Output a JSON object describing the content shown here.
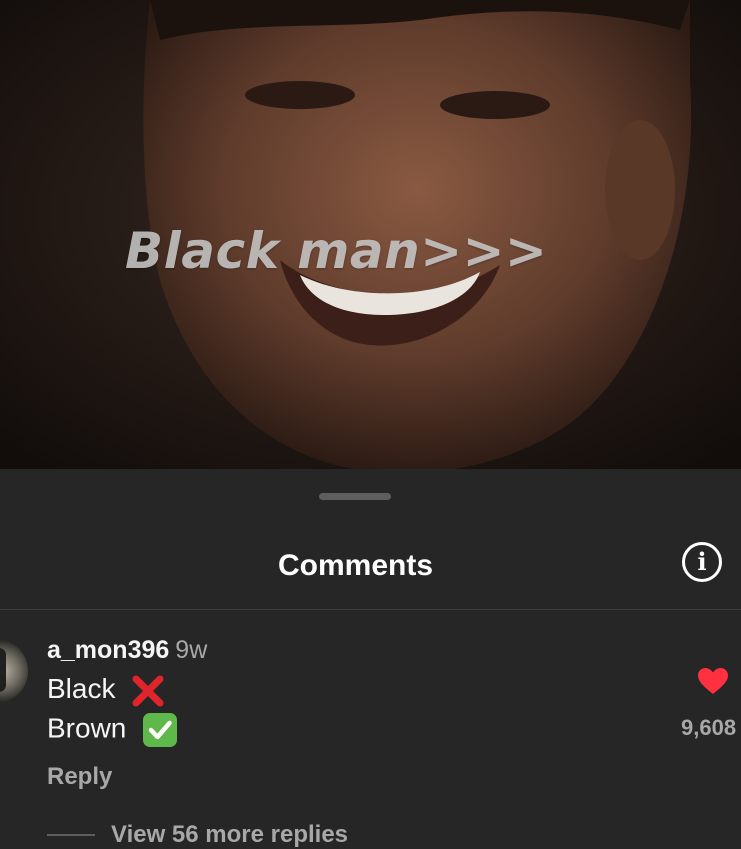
{
  "video": {
    "overlay_text": "Black man>>>"
  },
  "sheet": {
    "title": "Comments",
    "info_icon": "info-icon"
  },
  "comment": {
    "username": "a_mon396",
    "time": "9w",
    "lines": [
      {
        "text": "Black",
        "emoji": "cross-mark-icon"
      },
      {
        "text": "Brown",
        "emoji": "check-mark-button-icon"
      }
    ],
    "reply_label": "Reply",
    "like_icon": "heart-icon",
    "like_count": "9,608",
    "view_replies": "View 56 more replies"
  },
  "colors": {
    "background": "#262626",
    "like": "#ff3040",
    "check": "#5fb84a",
    "cross": "#e0242b",
    "secondary_text": "#a8a8a8"
  }
}
